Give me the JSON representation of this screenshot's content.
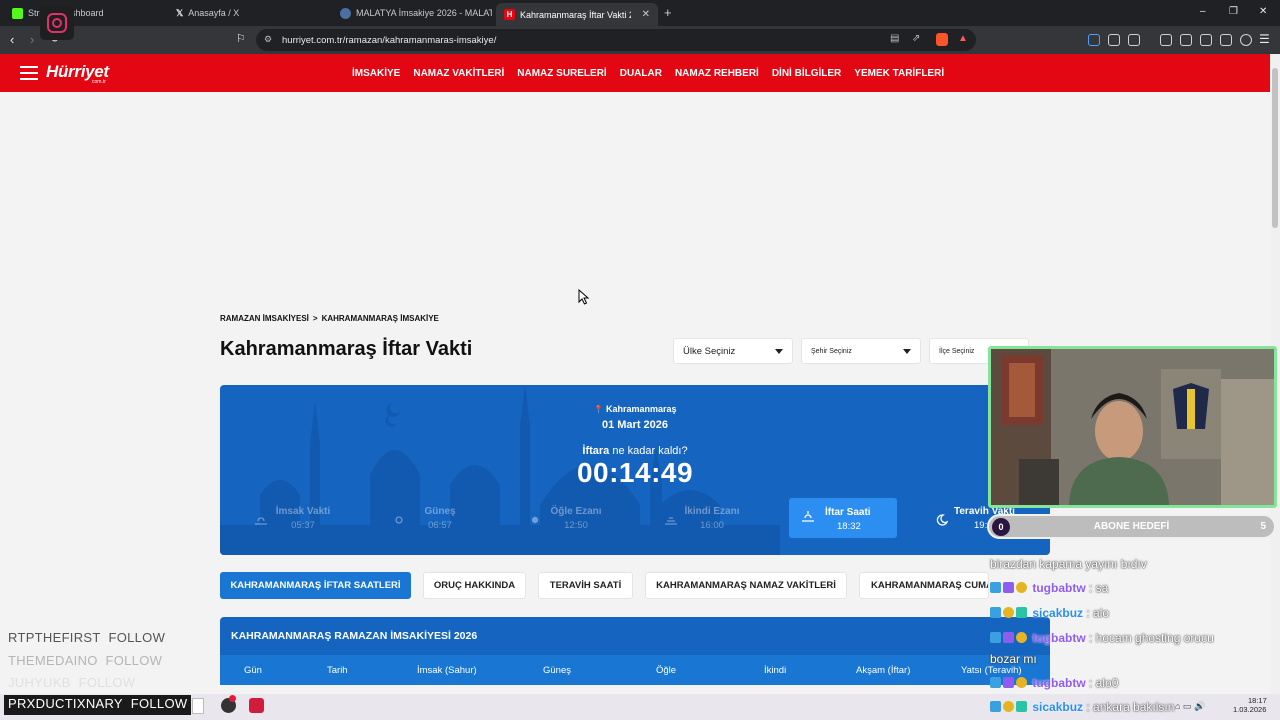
{
  "browser": {
    "tabs": [
      {
        "label": "Stream Dashboard",
        "icon": "kick-icon",
        "color": "#53fc18"
      },
      {
        "label": "Anasayfa / X",
        "icon": "x-icon",
        "color": "#e8eaed"
      },
      {
        "label": "MALATYA İmsakiye 2026 - MALATYA",
        "icon": "globe-icon",
        "color": "#4a6fa5"
      },
      {
        "label": "Kahramanmaraş İftar Vakti 2026",
        "icon": "hurriyet-icon",
        "color": "#e30613",
        "active": true
      }
    ],
    "url": "hurriyet.com.tr/ramazan/kahramanmaras-imsakiye/",
    "window_controls": {
      "minimize": "–",
      "restore": "❐",
      "close": "✕"
    },
    "new_tab": "+"
  },
  "site": {
    "logo": "Hürriyet",
    "logo_sub": "com.tr",
    "nav": [
      "İMSAKİYE",
      "NAMAZ VAKİTLERİ",
      "NAMAZ SURELERİ",
      "DUALAR",
      "NAMAZ REHBERİ",
      "DİNİ BİLGİLER",
      "YEMEK TARİFLERİ"
    ]
  },
  "page": {
    "breadcrumb": [
      "RAMAZAN İMSAKİYESİ",
      ">",
      "KAHRAMANMARAŞ İMSAKİYE"
    ],
    "title": "Kahramanmaraş İftar Vakti",
    "selects": {
      "country": "Ülke Seçiniz",
      "city": "Şehir Seçiniz",
      "district": "İlçe Seçiniz"
    }
  },
  "hero": {
    "city": "Kahramanmaraş",
    "date": "01 Mart 2026",
    "remain_bold": "İftara",
    "remain_rest": " ne kadar kaldı?",
    "countdown": "00:14:49",
    "prayers": [
      {
        "name": "İmsak Vakti",
        "time": "05:37"
      },
      {
        "name": "Güneş",
        "time": "06:57"
      },
      {
        "name": "Öğle Ezanı",
        "time": "12:50"
      },
      {
        "name": "İkindi Ezanı",
        "time": "16:00"
      }
    ],
    "iftar": {
      "name": "İftar Saati",
      "time": "18:32"
    },
    "teravih": {
      "name": "Teravih Vakti",
      "time": "19:"
    }
  },
  "tabs": [
    {
      "label": "KAHRAMANMARAŞ İFTAR SAATLERİ",
      "active": true
    },
    {
      "label": "ORUÇ HAKKINDA"
    },
    {
      "label": "TERAVİH SAATİ"
    },
    {
      "label": "KAHRAMANMARAŞ NAMAZ VAKİTLERİ"
    },
    {
      "label": "KAHRAMANMARAŞ CUMA"
    }
  ],
  "table": {
    "title": "KAHRAMANMARAŞ RAMAZAN İMSAKİYESİ 2026",
    "columns": [
      "Gün",
      "Tarih",
      "İmsak (Sahur)",
      "Güneş",
      "Öğle",
      "İkindi",
      "Akşam (İftar)",
      "Yatsı (Teravih)"
    ]
  },
  "taskbar": {
    "time": "18:17",
    "date": "1.03.2026"
  },
  "stream": {
    "follows": [
      {
        "name": "RTPTHEFIRST",
        "action": "FOLLOW"
      },
      {
        "name": "THEMEDAINO",
        "action": "FOLLOW"
      },
      {
        "name": "JUHYUKB",
        "action": "FOLLOW"
      }
    ],
    "follow_main": {
      "name": "PRXDUCTIXNARY",
      "action": "FOLLOW"
    },
    "sub_goal": {
      "current": "0",
      "label": "ABONE HEDEFİ",
      "target": "5"
    },
    "chat": [
      {
        "user": "",
        "msg": "birazdan kapama yayını bıdıv"
      },
      {
        "user": "tugbabtw",
        "msg": ": sa"
      },
      {
        "user": "sicakbuz",
        "msg": ": alo"
      },
      {
        "user": "tugbabtw",
        "msg": ": hocam ghosting orucu"
      },
      {
        "user": "",
        "msg": "bozar mı"
      },
      {
        "user": "tugbabtw",
        "msg": ": alo0"
      },
      {
        "user": "sicakbuz",
        "msg": ": ankara bakılsın"
      }
    ]
  },
  "colors": {
    "brand_red": "#e30613",
    "hero_blue": "#1565c0",
    "tab_blue": "#1976d2",
    "iftar_blue": "#2b8ef0",
    "webcam_border": "#86e39a"
  }
}
